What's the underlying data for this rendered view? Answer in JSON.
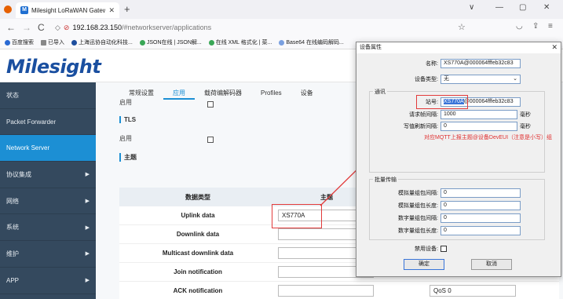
{
  "browser": {
    "tab_title": "Milesight LoRaWAN Gateway",
    "tab_close": "✕",
    "new_tab": "+",
    "url_host": "192.168.23.150",
    "url_path": "/#networkserver/applications",
    "back": "←",
    "forward": "→",
    "reload": "C",
    "minimize": "—",
    "maximize": "▢",
    "close": "✕",
    "chevron": "∨"
  },
  "bookmarks": [
    {
      "label": "百度搜索",
      "color": "#2a6ad3"
    },
    {
      "label": "已导入",
      "color": "#888888"
    },
    {
      "label": "上海迅协自动化科技...",
      "color": "#1d4e9e"
    },
    {
      "label": "JSON在线 | JSON解...",
      "color": "#3aa757"
    },
    {
      "label": "在线 XML 格式化 | 菜...",
      "color": "#3aa757"
    },
    {
      "label": "Base64 在线编码解码...",
      "color": "#7aa0e0"
    }
  ],
  "app": {
    "logo": "Milesight"
  },
  "sidebar": {
    "items": [
      {
        "label": "状态",
        "arrow": ""
      },
      {
        "label": "Packet Forwarder",
        "arrow": ""
      },
      {
        "label": "Network Server",
        "arrow": ""
      },
      {
        "label": "协议集成",
        "arrow": "▶"
      },
      {
        "label": "网络",
        "arrow": "▶"
      },
      {
        "label": "系统",
        "arrow": "▶"
      },
      {
        "label": "维护",
        "arrow": "▶"
      },
      {
        "label": "APP",
        "arrow": "▶"
      }
    ]
  },
  "content": {
    "tabs": [
      "常规设置",
      "应用",
      "载荷编解码器",
      "Profiles",
      "设备"
    ],
    "field_top": "启用",
    "tls_label": "TLS",
    "enable_label": "启用",
    "topic_section": "主题",
    "table": {
      "col_type": "数据类型",
      "col_topic": "主题",
      "rows": [
        {
          "type": "Uplink data",
          "topic": "XS770A"
        },
        {
          "type": "Downlink data",
          "topic": ""
        },
        {
          "type": "Multicast downlink data",
          "topic": ""
        },
        {
          "type": "Join notification",
          "topic": ""
        },
        {
          "type": "ACK notification",
          "topic": ""
        }
      ]
    },
    "qos_value": "QoS 0"
  },
  "dialog": {
    "title": "设备属性",
    "close": "✕",
    "name_label": "名称:",
    "name_value": "XS770A@000064fffeb32c83",
    "type_label": "设备类型:",
    "type_value": "无",
    "comm_group": "通讯",
    "station_label": "站号:",
    "station_value_hl": "XS770A",
    "station_value_rest": "@000064fffeb32c83",
    "req_label": "请求帧间隔:",
    "req_value": "1000",
    "write_label": "写值刷新间隔:",
    "write_value": "0",
    "unit_ms": "毫秒",
    "note": "对应MQTT上报主题@设备DevEUI（注意是小写）组",
    "batch_group": "批量传输",
    "analog_interval_label": "模拟量组包间隔:",
    "analog_interval_value": "0",
    "analog_length_label": "模拟量组包长度:",
    "analog_length_value": "0",
    "digital_interval_label": "数字量组包间隔:",
    "digital_interval_value": "0",
    "digital_length_label": "数字量组包长度:",
    "digital_length_value": "0",
    "disable_label": "禁用设备:",
    "ok": "确定",
    "cancel": "取消"
  },
  "colors": {
    "sidebar_bg": "#34495e",
    "sidebar_active": "#1c8fd4",
    "brand": "#1a4fa0",
    "annotation": "#e23b3b"
  }
}
